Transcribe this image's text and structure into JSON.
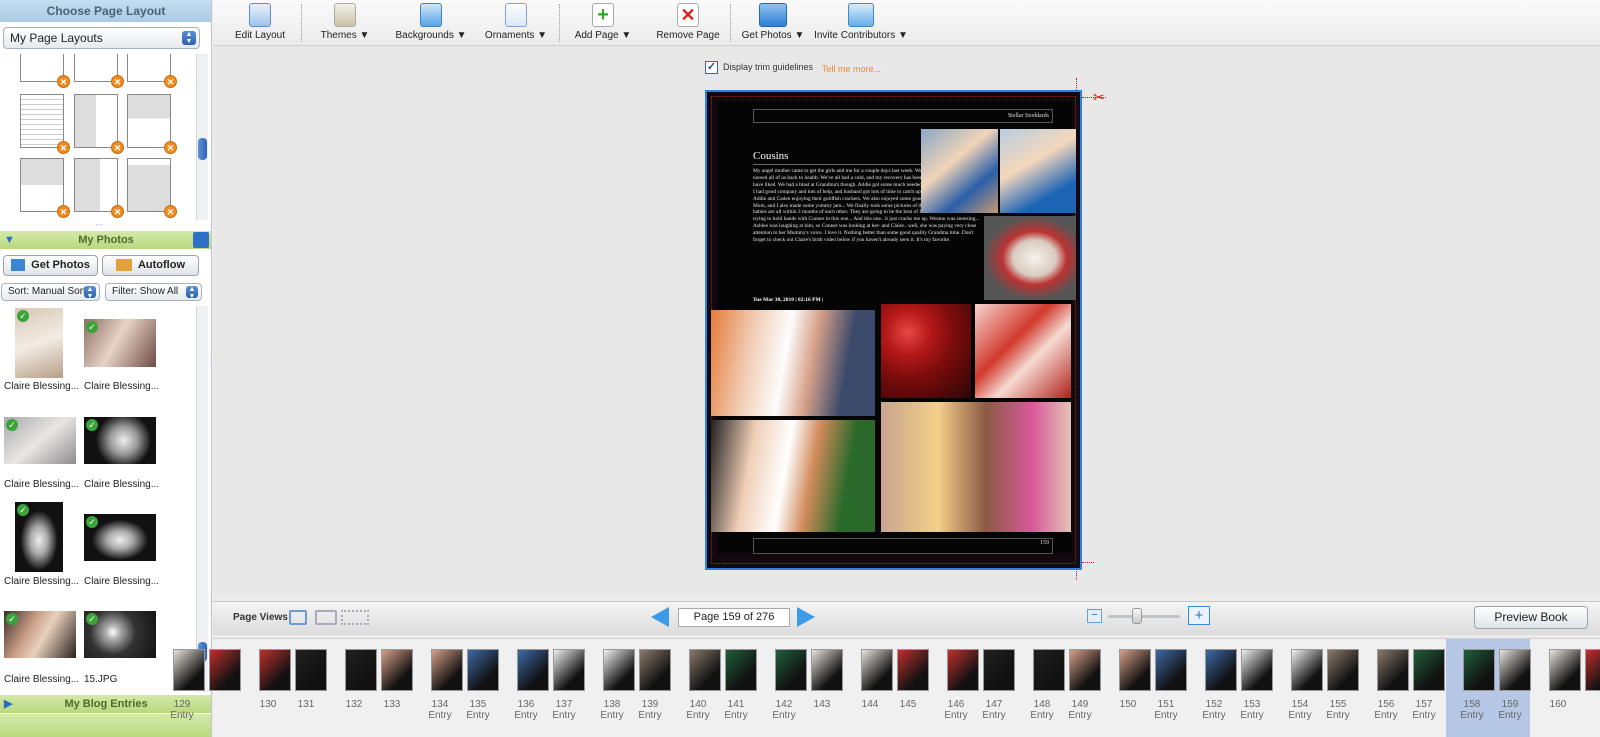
{
  "left_panel": {
    "layout_header": "Choose Page Layout",
    "layout_select": "My Page Layouts",
    "photos_header": "My Photos",
    "get_photos_label": "Get Photos",
    "autoflow_label": "Autoflow",
    "sort_select": "Sort:  Manual Sort",
    "filter_select": "Filter: Show All",
    "photos": [
      {
        "caption": "Claire Blessing..."
      },
      {
        "caption": "Claire Blessing..."
      },
      {
        "caption": "Claire Blessing..."
      },
      {
        "caption": "Claire Blessing..."
      },
      {
        "caption": "Claire Blessing..."
      },
      {
        "caption": "Claire Blessing..."
      },
      {
        "caption": "Claire Blessing..."
      },
      {
        "caption": "15.JPG"
      }
    ],
    "blog_header": "My Blog Entries"
  },
  "toolbar": {
    "edit_layout": "Edit Layout",
    "themes": "Themes ▼",
    "backgrounds": "Backgrounds ▼",
    "ornaments": "Ornaments ▼",
    "add_page": "Add Page ▼",
    "remove_page": "Remove Page",
    "get_photos": "Get Photos ▼",
    "invite_contributors": "Invite Contributors ▼"
  },
  "canvas": {
    "trim_label": "Display trim guidelines",
    "trim_checked": true,
    "tell_me_more": "Tell me more...",
    "page": {
      "header_text": "Stellar Stoddards",
      "title": "Cousins",
      "body": "My angel mother came to get the girls and me for a couple days last week. We went home with her and she nursed all of us back to health. We've all had a cold, and my recovery has been a little slower than I would have liked. We had a blast at Grandma's though. Addie got some much needed attention. Claire got to rest, I had good company and lots of help, and husband got lots of time to catch up on school work. Here is Addie and Caden enjoying their goldfish crackers. We also enjoyed some good take out for lunch... Ash, Mom, and I also made some yummy jam... We finally took some pictures of the babies together! These babies are all within 3 months of each other. They are going to be the best of friends! I love how Claire is trying to hold hands with Conner in this one... And this one.. it just cracks me up. Weston was sneezing... Ashlee was laughing at him, so Conner was looking at her- and Claire.. well, she was paying very close attention to her Mummy's voice. I love it. Nothing better than some good quality Grandma time. Don't forget to check out Claire's birth video below if you haven't already seen it. It's my favorite.",
      "dateline": "Tue Mar 30, 2010 | 02:16 PM |",
      "page_number": "159"
    }
  },
  "page_views": {
    "label": "Page Views",
    "page_indicator": "Page 159 of 276",
    "preview_book": "Preview Book"
  },
  "filmstrip": [
    {
      "left": "129",
      "left_sub": "Entry",
      "right": "",
      "right_sub": ""
    },
    {
      "left": "130",
      "left_sub": "",
      "right": "131",
      "right_sub": ""
    },
    {
      "left": "132",
      "left_sub": "",
      "right": "133",
      "right_sub": ""
    },
    {
      "left": "134",
      "left_sub": "Entry",
      "right": "135",
      "right_sub": "Entry"
    },
    {
      "left": "136",
      "left_sub": "Entry",
      "right": "137",
      "right_sub": "Entry"
    },
    {
      "left": "138",
      "left_sub": "Entry",
      "right": "139",
      "right_sub": "Entry"
    },
    {
      "left": "140",
      "left_sub": "Entry",
      "right": "141",
      "right_sub": "Entry"
    },
    {
      "left": "142",
      "left_sub": "Entry",
      "right": "143",
      "right_sub": ""
    },
    {
      "left": "144",
      "left_sub": "",
      "right": "145",
      "right_sub": ""
    },
    {
      "left": "146",
      "left_sub": "Entry",
      "right": "147",
      "right_sub": "Entry"
    },
    {
      "left": "148",
      "left_sub": "Entry",
      "right": "149",
      "right_sub": "Entry"
    },
    {
      "left": "150",
      "left_sub": "",
      "right": "151",
      "right_sub": "Entry"
    },
    {
      "left": "152",
      "left_sub": "Entry",
      "right": "153",
      "right_sub": "Entry"
    },
    {
      "left": "154",
      "left_sub": "Entry",
      "right": "155",
      "right_sub": "Entry"
    },
    {
      "left": "156",
      "left_sub": "Entry",
      "right": "157",
      "right_sub": "Entry"
    },
    {
      "left": "158",
      "left_sub": "Entry",
      "right": "159",
      "right_sub": "Entry"
    },
    {
      "left": "160",
      "left_sub": "",
      "right": "",
      "right_sub": ""
    }
  ]
}
